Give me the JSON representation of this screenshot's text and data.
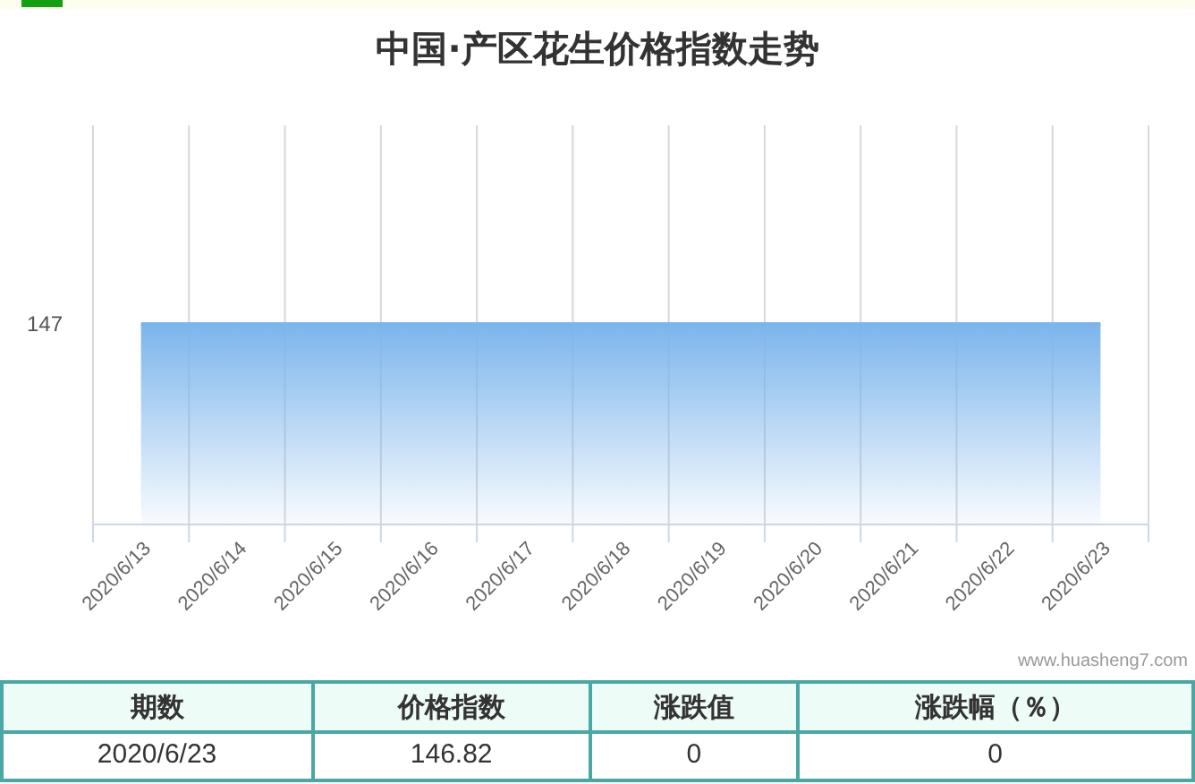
{
  "title": "中国·产区花生价格指数走势",
  "chart": {
    "y_label": "147",
    "x_labels": [
      "2020/6/13",
      "2020/6/14",
      "2020/6/15",
      "2020/6/16",
      "2020/6/17",
      "2020/6/18",
      "2020/6/19",
      "2020/6/20",
      "2020/6/21",
      "2020/6/22",
      "2020/6/23"
    ],
    "credit": "www.huasheng7.com"
  },
  "table": {
    "columns": [
      "期数",
      "价格指数",
      "涨跌值",
      "涨跌幅（％）"
    ],
    "rows": [
      [
        "2020/6/23",
        "146.82",
        "0",
        "0"
      ]
    ]
  }
}
